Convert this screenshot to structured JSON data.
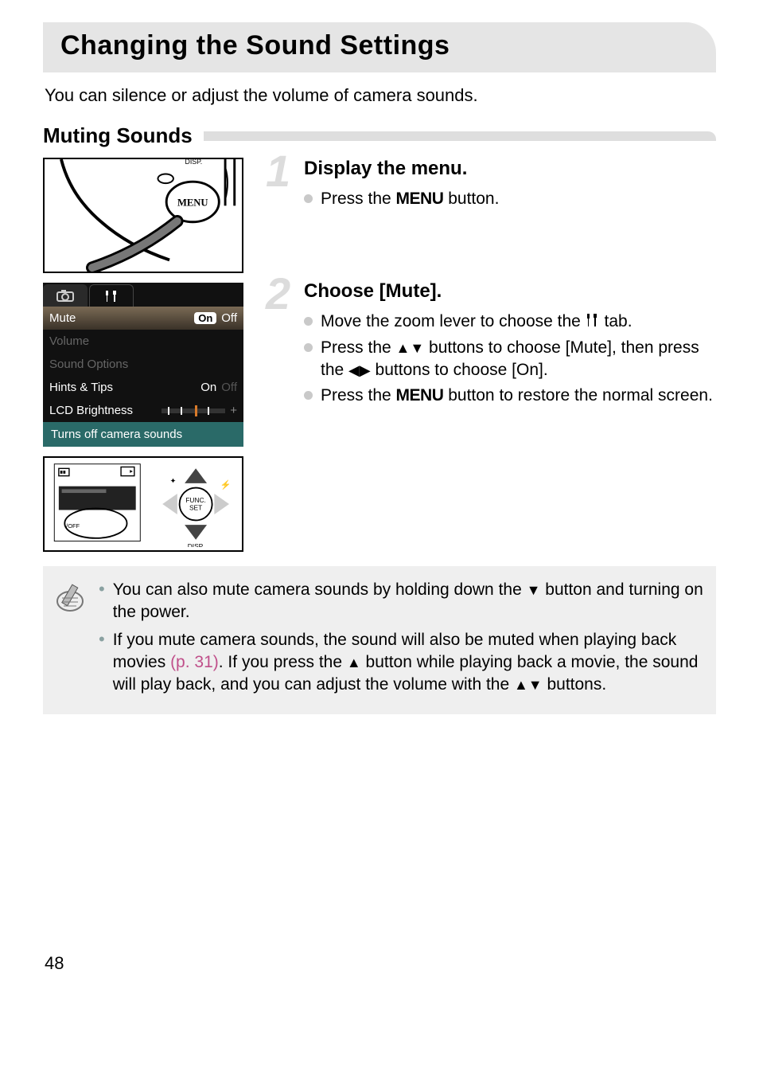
{
  "title": "Changing the Sound Settings",
  "intro": "You can silence or adjust the volume of camera sounds.",
  "section": {
    "title": "Muting Sounds"
  },
  "icons": {
    "menu_label": "MENU",
    "disp_label": "DISP.",
    "func_label": "FUNC.",
    "set_label": "SET"
  },
  "lcd": {
    "tab_camera_icon": "camera-icon",
    "tab_tools_icon": "tools-icon",
    "rows": [
      {
        "label": "Mute",
        "on": "On",
        "off": "Off",
        "selected": true
      },
      {
        "label": "Volume",
        "dim": true
      },
      {
        "label": "Sound Options",
        "dim": true
      },
      {
        "label": "Hints & Tips",
        "value": "On",
        "off_dim": "Off"
      },
      {
        "label": "LCD Brightness",
        "slider": true
      }
    ],
    "plus": "+",
    "footer": "Turns off camera sounds"
  },
  "steps": [
    {
      "num": "1",
      "title": "Display the menu.",
      "bullets": [
        {
          "pre": "Press the ",
          "menu": "MENU",
          "post": " button."
        }
      ]
    },
    {
      "num": "2",
      "title": "Choose [Mute].",
      "bullets": [
        {
          "text_a": "Move the zoom lever to choose the ",
          "tools_icon": true,
          "text_b": " tab."
        },
        {
          "text_a": "Press the ",
          "updown": true,
          "text_b": " buttons to choose [Mute], then press the ",
          "leftright": true,
          "text_c": " buttons to choose [On]."
        },
        {
          "text_a": "Press the ",
          "menu": "MENU",
          "text_b": " button to restore the normal screen."
        }
      ]
    }
  ],
  "note": {
    "items": [
      {
        "a": "You can also mute camera sounds by holding down the ",
        "down": true,
        "b": " button and turning on the power."
      },
      {
        "a": "If you mute camera sounds, the sound will also be muted when playing back movies ",
        "link": "(p. 31)",
        "b": ". If you press the ",
        "up": true,
        "c": " button while playing back a movie, the sound will play back, and you can adjust the volume with the ",
        "updown": true,
        "d": " buttons."
      }
    ]
  },
  "page_number": "48"
}
